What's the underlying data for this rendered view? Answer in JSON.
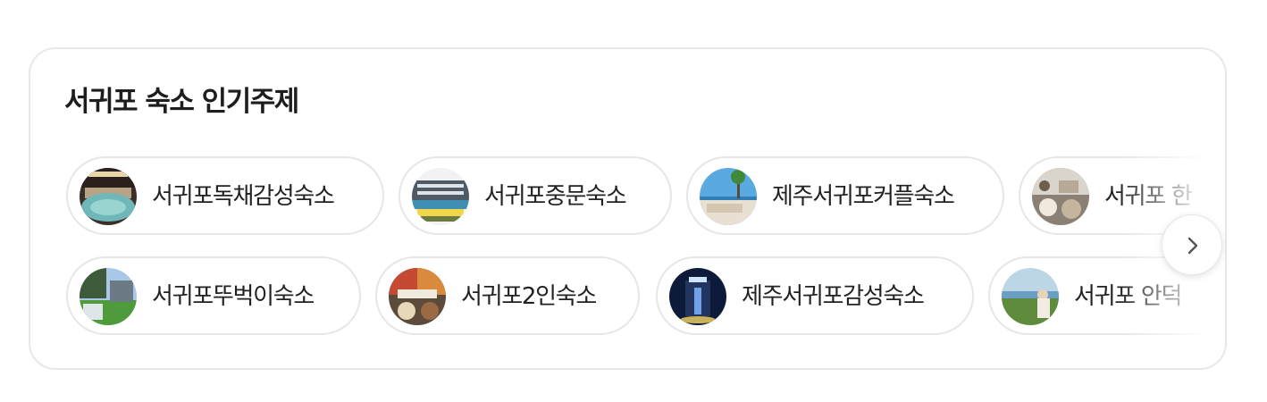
{
  "section": {
    "title": "서귀포 숙소 인기주제"
  },
  "rows": [
    [
      {
        "label": "서귀포독채감성숙소",
        "icon": "indoor-pool-photo"
      },
      {
        "label": "서귀포중문숙소",
        "icon": "hotel-pool-photo"
      },
      {
        "label": "제주서귀포커플숙소",
        "icon": "beach-palm-photo"
      },
      {
        "label": "서귀포 한",
        "icon": "food-table-photo"
      }
    ],
    [
      {
        "label": "서귀포뚜벅이숙소",
        "icon": "house-lawn-photo"
      },
      {
        "label": "서귀포2인숙소",
        "icon": "food-collage-photo"
      },
      {
        "label": "제주서귀포감성숙소",
        "icon": "night-building-photo"
      },
      {
        "label": "서귀포 안덕",
        "icon": "ocean-view-photo"
      }
    ]
  ],
  "next_button": {
    "icon": "chevron-right-icon"
  },
  "colors": {
    "border": "#e6e6ea",
    "text": "#222222",
    "title": "#1d1d1f"
  }
}
